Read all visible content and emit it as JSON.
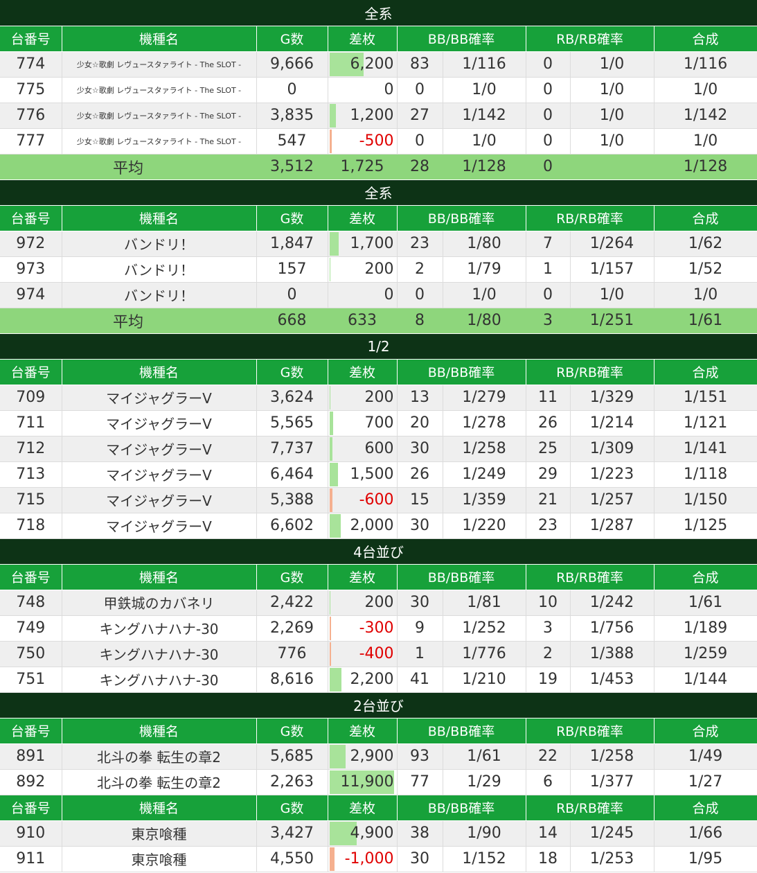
{
  "headers": [
    "台番号",
    "機種名",
    "G数",
    "差枚",
    "BB/BB確率",
    "RB/RB確率",
    "合成"
  ],
  "avg_label": "平均",
  "sections": [
    {
      "title": "全系",
      "small_names": true,
      "rows": [
        {
          "no": "774",
          "name": "少女☆歌劇 レヴュースタァライト - The SLOT -",
          "g": "9,666",
          "diff": "6,200",
          "bb": "83",
          "bbp": "1/116",
          "rb": "0",
          "rbp": "1/0",
          "gous": "1/116",
          "bar": 0.52
        },
        {
          "no": "775",
          "name": "少女☆歌劇 レヴュースタァライト - The SLOT -",
          "g": "0",
          "diff": "0",
          "bb": "0",
          "bbp": "1/0",
          "rb": "0",
          "rbp": "1/0",
          "gous": "1/0",
          "bar": 0
        },
        {
          "no": "776",
          "name": "少女☆歌劇 レヴュースタァライト - The SLOT -",
          "g": "3,835",
          "diff": "1,200",
          "bb": "27",
          "bbp": "1/142",
          "rb": "0",
          "rbp": "1/0",
          "gous": "1/142",
          "bar": 0.1
        },
        {
          "no": "777",
          "name": "少女☆歌劇 レヴュースタァライト - The SLOT -",
          "g": "547",
          "diff": "-500",
          "bb": "0",
          "bbp": "1/0",
          "rb": "0",
          "rbp": "1/0",
          "gous": "1/0",
          "bar": -0.04
        }
      ],
      "avg": {
        "g": "3,512",
        "diff": "1,725",
        "bb": "28",
        "bbp": "1/128",
        "rb": "0",
        "rbp": "",
        "gous": "1/128"
      }
    },
    {
      "title": "全系",
      "rows": [
        {
          "no": "972",
          "name": "バンドリ！",
          "g": "1,847",
          "diff": "1,700",
          "bb": "23",
          "bbp": "1/80",
          "rb": "7",
          "rbp": "1/264",
          "gous": "1/62",
          "bar": 0.14
        },
        {
          "no": "973",
          "name": "バンドリ！",
          "g": "157",
          "diff": "200",
          "bb": "2",
          "bbp": "1/79",
          "rb": "1",
          "rbp": "1/157",
          "gous": "1/52",
          "bar": 0.02
        },
        {
          "no": "974",
          "name": "バンドリ！",
          "g": "0",
          "diff": "0",
          "bb": "0",
          "bbp": "1/0",
          "rb": "0",
          "rbp": "1/0",
          "gous": "1/0",
          "bar": 0
        }
      ],
      "avg": {
        "g": "668",
        "diff": "633",
        "bb": "8",
        "bbp": "1/80",
        "rb": "3",
        "rbp": "1/251",
        "gous": "1/61"
      }
    },
    {
      "title": "1/2",
      "rows": [
        {
          "no": "709",
          "name": "マイジャグラーV",
          "g": "3,624",
          "diff": "200",
          "bb": "13",
          "bbp": "1/279",
          "rb": "11",
          "rbp": "1/329",
          "gous": "1/151",
          "bar": 0.02
        },
        {
          "no": "711",
          "name": "マイジャグラーV",
          "g": "5,565",
          "diff": "700",
          "bb": "20",
          "bbp": "1/278",
          "rb": "26",
          "rbp": "1/214",
          "gous": "1/121",
          "bar": 0.06
        },
        {
          "no": "712",
          "name": "マイジャグラーV",
          "g": "7,737",
          "diff": "600",
          "bb": "30",
          "bbp": "1/258",
          "rb": "25",
          "rbp": "1/309",
          "gous": "1/141",
          "bar": 0.05
        },
        {
          "no": "713",
          "name": "マイジャグラーV",
          "g": "6,464",
          "diff": "1,500",
          "bb": "26",
          "bbp": "1/249",
          "rb": "29",
          "rbp": "1/223",
          "gous": "1/118",
          "bar": 0.13
        },
        {
          "no": "715",
          "name": "マイジャグラーV",
          "g": "5,388",
          "diff": "-600",
          "bb": "15",
          "bbp": "1/359",
          "rb": "21",
          "rbp": "1/257",
          "gous": "1/150",
          "bar": -0.05
        },
        {
          "no": "718",
          "name": "マイジャグラーV",
          "g": "6,602",
          "diff": "2,000",
          "bb": "30",
          "bbp": "1/220",
          "rb": "23",
          "rbp": "1/287",
          "gous": "1/125",
          "bar": 0.17
        }
      ]
    },
    {
      "title": "4台並び",
      "rows": [
        {
          "no": "748",
          "name": "甲鉄城のカバネリ",
          "g": "2,422",
          "diff": "200",
          "bb": "30",
          "bbp": "1/81",
          "rb": "10",
          "rbp": "1/242",
          "gous": "1/61",
          "bar": 0.02
        },
        {
          "no": "749",
          "name": "キングハナハナ-30",
          "g": "2,269",
          "diff": "-300",
          "bb": "9",
          "bbp": "1/252",
          "rb": "3",
          "rbp": "1/756",
          "gous": "1/189",
          "bar": -0.03
        },
        {
          "no": "750",
          "name": "キングハナハナ-30",
          "g": "776",
          "diff": "-400",
          "bb": "1",
          "bbp": "1/776",
          "rb": "2",
          "rbp": "1/388",
          "gous": "1/259",
          "bar": -0.03
        },
        {
          "no": "751",
          "name": "キングハナハナ-30",
          "g": "8,616",
          "diff": "2,200",
          "bb": "41",
          "bbp": "1/210",
          "rb": "19",
          "rbp": "1/453",
          "gous": "1/144",
          "bar": 0.18
        }
      ]
    },
    {
      "title": "2台並び",
      "rows": [
        {
          "no": "891",
          "name": "北斗の拳 転生の章2",
          "g": "5,685",
          "diff": "2,900",
          "bb": "93",
          "bbp": "1/61",
          "rb": "22",
          "rbp": "1/258",
          "gous": "1/49",
          "bar": 0.24
        },
        {
          "no": "892",
          "name": "北斗の拳 転生の章2",
          "g": "2,263",
          "diff": "11,900",
          "bb": "77",
          "bbp": "1/29",
          "rb": "6",
          "rbp": "1/377",
          "gous": "1/27",
          "bar": 0.97
        }
      ]
    },
    {
      "title": "",
      "rows": [
        {
          "no": "910",
          "name": "東京喰種",
          "g": "3,427",
          "diff": "4,900",
          "bb": "38",
          "bbp": "1/90",
          "rb": "14",
          "rbp": "1/245",
          "gous": "1/66",
          "bar": 0.41
        },
        {
          "no": "911",
          "name": "東京喰種",
          "g": "4,550",
          "diff": "-1,000",
          "bb": "30",
          "bbp": "1/152",
          "rb": "18",
          "rbp": "1/253",
          "gous": "1/95",
          "bar": -0.08
        }
      ]
    }
  ]
}
